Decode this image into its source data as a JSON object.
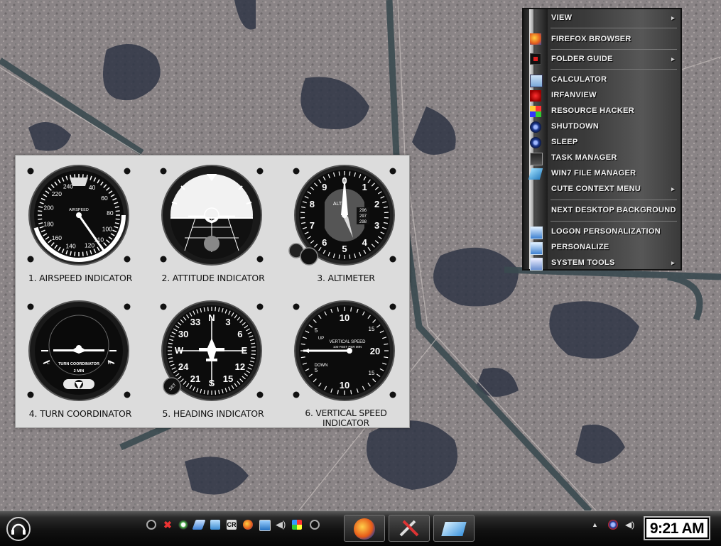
{
  "gauges": [
    {
      "id": "airspeed",
      "label": "1. AIRSPEED INDICATOR",
      "scale": [
        "40",
        "60",
        "80",
        "100",
        "110",
        "120",
        "140",
        "160",
        "180",
        "200",
        "220",
        "240"
      ],
      "center_text": "AIRSPEED"
    },
    {
      "id": "attitude",
      "label": "2. ATTITUDE INDICATOR"
    },
    {
      "id": "altimeter",
      "label": "3. ALTIMETER",
      "scale": [
        "0",
        "1",
        "2",
        "3",
        "4",
        "5",
        "6",
        "7",
        "8",
        "9"
      ],
      "center_text": "ALT",
      "kollsman": [
        "296",
        "297",
        "298"
      ]
    },
    {
      "id": "turn-coordinator",
      "label": "4. TURN COORDINATOR",
      "center_text": "TURN COORDINATOR",
      "sub_text": "2 MIN",
      "left_mark": "L",
      "right_mark": "R"
    },
    {
      "id": "heading",
      "label": "5. HEADING INDICATOR",
      "scale": [
        "N",
        "3",
        "6",
        "E",
        "12",
        "15",
        "S",
        "21",
        "24",
        "W",
        "30",
        "33"
      ],
      "knob_text": "SET"
    },
    {
      "id": "vsi",
      "label": "6. VERTICAL SPEED INDICATOR",
      "scale": [
        "5",
        "10",
        "15",
        "20",
        "15",
        "10",
        "5"
      ],
      "center_text": "VERTICAL SPEED",
      "sub_text": "100 FEET PER MIN",
      "up": "UP",
      "down": "DOWN"
    }
  ],
  "context_menu": {
    "items": [
      {
        "label": "VIEW",
        "submenu": true
      },
      {
        "label": "FIREFOX BROWSER",
        "submenu": false,
        "icon": "firefox-icon"
      },
      {
        "label": "FOLDER GUIDE",
        "submenu": true,
        "icon": "folder-guide-icon"
      },
      {
        "label": "CALCULATOR",
        "submenu": false,
        "icon": "calculator-icon"
      },
      {
        "label": "IRFANVIEW",
        "submenu": false,
        "icon": "irfanview-icon"
      },
      {
        "label": "RESOURCE HACKER",
        "submenu": false,
        "icon": "resource-hacker-icon"
      },
      {
        "label": "SHUTDOWN",
        "submenu": false,
        "icon": "shutdown-icon"
      },
      {
        "label": "SLEEP",
        "submenu": false,
        "icon": "sleep-icon"
      },
      {
        "label": "TASK MANAGER",
        "submenu": false,
        "icon": "task-manager-icon"
      },
      {
        "label": "WIN7 FILE MANAGER",
        "submenu": false,
        "icon": "file-manager-icon"
      },
      {
        "label": "CUTE CONTEXT MENU",
        "submenu": true
      },
      {
        "label": "NEXT DESKTOP BACKGROUND",
        "submenu": false
      },
      {
        "label": "LOGON PERSONALIZATION",
        "submenu": false,
        "icon": "logon-icon"
      },
      {
        "label": "PERSONALIZE",
        "submenu": false,
        "icon": "personalize-icon"
      },
      {
        "label": "SYSTEM TOOLS",
        "submenu": true,
        "icon": "system-tools-icon"
      }
    ],
    "submenu_arrow": "▸"
  },
  "taskbar": {
    "clock": "9:21 AM",
    "tray_up_arrow": "▲",
    "quick_launch": [
      "close-icon",
      "network-icon",
      "mail-icon",
      "folder-icon",
      "cr-icon",
      "firefox-icon",
      "monitor-icon",
      "volume-icon",
      "paint-icon"
    ],
    "cr_text": "CR",
    "tasks": [
      "firefox-task",
      "tools-task",
      "explorer-task"
    ]
  },
  "colors": {
    "menu_text": "#f2f2f2",
    "taskbar": "#111111",
    "panel": "#dcdcdc"
  }
}
